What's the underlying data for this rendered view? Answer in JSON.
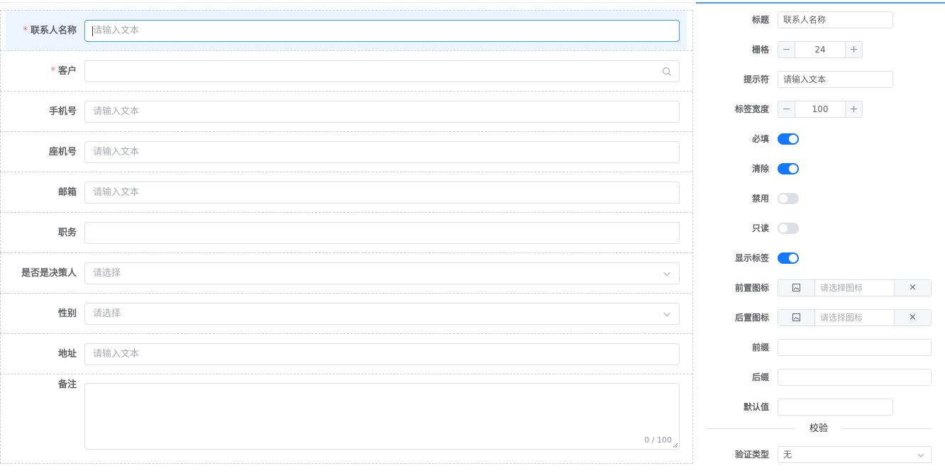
{
  "form": {
    "fields": [
      {
        "label": "联系人名称",
        "required": true,
        "placeholder": "请输入文本",
        "type": "text"
      },
      {
        "label": "客户",
        "required": true,
        "placeholder": "",
        "type": "search"
      },
      {
        "label": "手机号",
        "required": false,
        "placeholder": "请输入文本",
        "type": "text"
      },
      {
        "label": "座机号",
        "required": false,
        "placeholder": "请输入文本",
        "type": "text"
      },
      {
        "label": "邮箱",
        "required": false,
        "placeholder": "请输入文本",
        "type": "text"
      },
      {
        "label": "职务",
        "required": false,
        "placeholder": "",
        "type": "text"
      },
      {
        "label": "是否是决策人",
        "required": false,
        "placeholder": "请选择",
        "type": "select"
      },
      {
        "label": "性别",
        "required": false,
        "placeholder": "请选择",
        "type": "select"
      },
      {
        "label": "地址",
        "required": false,
        "placeholder": "请输入文本",
        "type": "text"
      }
    ],
    "remark": {
      "label": "备注",
      "counter": "0 / 100"
    },
    "required_mark": "*"
  },
  "panel": {
    "title": {
      "label": "标题",
      "value": "联系人名称"
    },
    "grid": {
      "label": "栅格",
      "value": "24",
      "minus": "−",
      "plus": "+"
    },
    "placeholder": {
      "label": "提示符",
      "value": "请输入文本"
    },
    "label_width": {
      "label": "标签宽度",
      "value": "100",
      "minus": "−",
      "plus": "+"
    },
    "switches": [
      {
        "label": "必填",
        "on": true
      },
      {
        "label": "清除",
        "on": true
      },
      {
        "label": "禁用",
        "on": false
      },
      {
        "label": "只读",
        "on": false
      },
      {
        "label": "显示标签",
        "on": true
      }
    ],
    "prefix_icon": {
      "label": "前置图标",
      "placeholder": "请选择图标",
      "clear": "×"
    },
    "suffix_icon": {
      "label": "后置图标",
      "placeholder": "请选择图标",
      "clear": "×"
    },
    "prefix": {
      "label": "前缀",
      "value": ""
    },
    "suffix": {
      "label": "后缀",
      "value": ""
    },
    "default_value": {
      "label": "默认值",
      "value": ""
    },
    "validation_divider": "校验",
    "validation_type": {
      "label": "验证类型",
      "value": "无"
    }
  },
  "colors": {
    "accent": "#409eff",
    "switch_on": "#1677ff",
    "required": "#f56c6c"
  }
}
